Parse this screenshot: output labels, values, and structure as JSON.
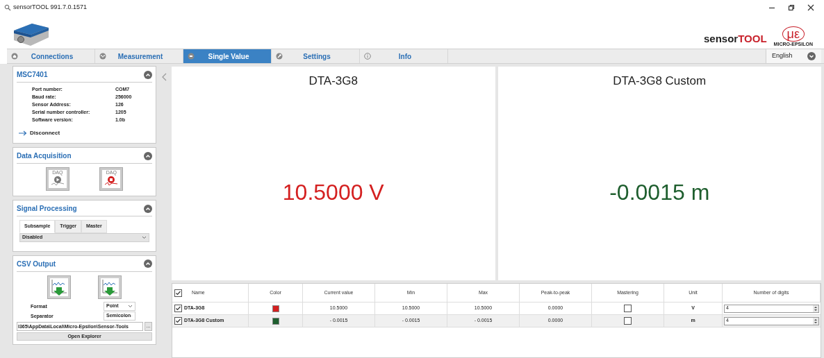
{
  "window": {
    "title": "sensorTOOL 991.7.0.1571"
  },
  "brand": {
    "product_plain": "sensor",
    "product_bold": "TOOL",
    "logo_mark": "με",
    "logo_caption": "MICRO-EPSILON"
  },
  "tabs": [
    {
      "label": "Connections",
      "selected": false
    },
    {
      "label": "Measurement",
      "selected": false
    },
    {
      "label": "Single Value",
      "selected": true
    },
    {
      "label": "Settings",
      "selected": false
    },
    {
      "label": "Info",
      "selected": false
    }
  ],
  "language": {
    "value": "English"
  },
  "sidebar": {
    "device": {
      "title": "MSC7401",
      "expanded": true,
      "fields": [
        {
          "label": "Port number:",
          "value": "COM7"
        },
        {
          "label": "Baud rate:",
          "value": "256000"
        },
        {
          "label": "Sensor Address:",
          "value": "126"
        },
        {
          "label": "Serial number controller:",
          "value": "1205"
        },
        {
          "label": "Software version:",
          "value": "1.0b"
        }
      ],
      "action": "Disconnect"
    },
    "data_acquisition": {
      "title": "Data Acquisition",
      "expanded": true,
      "buttons": [
        {
          "kind": "start",
          "label": "DAQ"
        },
        {
          "kind": "stop",
          "label": "DAQ"
        }
      ]
    },
    "signal_processing": {
      "title": "Signal Processing",
      "expanded": true,
      "tabs": [
        {
          "label": "Subsample",
          "selected": true
        },
        {
          "label": "Trigger",
          "selected": false
        },
        {
          "label": "Master",
          "selected": false
        }
      ],
      "mode": "Disabled"
    },
    "csv_output": {
      "title": "CSV Output",
      "expanded": true,
      "format_label": "Format",
      "format": "Point",
      "separator_label": "Separator",
      "separator": "Semicolon",
      "path": "l365\\AppData\\Local\\Micro-Epsilon\\Sensor-Tools",
      "browse": "...",
      "open": "Open Explorer"
    }
  },
  "displays": [
    {
      "title": "DTA-3G8",
      "value": "10.5000 V",
      "color": "#d42020"
    },
    {
      "title": "DTA-3G8 Custom",
      "value": "-0.0015 m",
      "color": "#1e5e2e"
    }
  ],
  "table": {
    "all_checked": true,
    "columns": [
      "Name",
      "Color",
      "Current value",
      "Min",
      "Max",
      "Peak-to-peak",
      "Mastering",
      "Unit",
      "Number of digits"
    ],
    "rows": [
      {
        "checked": true,
        "name": "DTA-3G8",
        "color": "#d42020",
        "current": "10.5000",
        "min": "10.5000",
        "max": "10.5000",
        "peak_to_peak": "0.0000",
        "mastering": false,
        "unit": "V",
        "digits": "4",
        "selected": false
      },
      {
        "checked": true,
        "name": "DTA-3G8 Custom",
        "color": "#1e5e2e",
        "current": "- 0.0015",
        "min": "- 0.0015",
        "max": "- 0.0015",
        "peak_to_peak": "0.0000",
        "mastering": false,
        "unit": "m",
        "digits": "4",
        "selected": true
      }
    ]
  }
}
